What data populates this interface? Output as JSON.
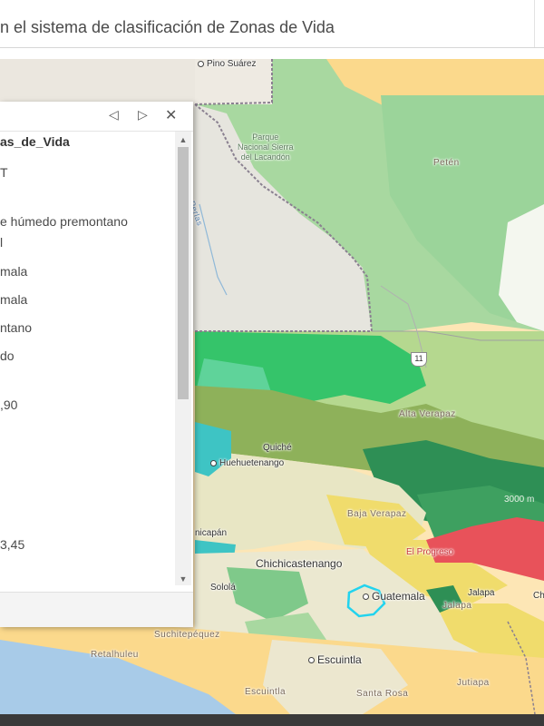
{
  "header": {
    "title": "n el sistema de clasificación de Zonas de Vida"
  },
  "popup": {
    "nav": {
      "prev": "◁",
      "next": "▷",
      "close": "✕"
    },
    "heading": "as_de_Vida",
    "rows": [
      "T",
      "e húmedo premontano",
      "l",
      "mala",
      "mala",
      "ntano",
      "do",
      ",90",
      "3,45"
    ]
  },
  "map": {
    "cities": {
      "pino_suarez": "Pino Suárez",
      "huehuetenango": "Huehuetenango",
      "chichicastenango": "Chichicastenango",
      "guatemala": "Guatemala",
      "jalapa": "Jalapa",
      "jalapa_dept": "Jalapa",
      "escuintla": "Escuintla",
      "solola": "Sololá",
      "quiche": "Quiché",
      "nicapan": "nicapán",
      "santa_rosa": "Santa Rosa",
      "escuintla_dept": "Escuintla",
      "suchitepequez": "Suchitepéquez",
      "retalhuleu": "Retalhuleu",
      "jutiapa": "Jutiapa",
      "chi": "Chi"
    },
    "regions": {
      "peten": "Petén",
      "alta_verapaz": "Alta Verapaz",
      "baja_verapaz": "Baja Verapaz",
      "el_progreso": "El Progreso",
      "perlas": "Perlas"
    },
    "park": [
      "Parque",
      "Nacional Sierra",
      "del Lacandón"
    ],
    "highway": "11",
    "elevation": "3000 m"
  },
  "colors": {
    "humid_forest": "#a8d8a0",
    "wet_forest": "#7fc98a",
    "dry_forest": "#fde6b5",
    "very_wet": "#35c46a",
    "montane": "#5fa860",
    "highland": "#8eb15a",
    "lower_montane": "#e7e4c0",
    "red_zone": "#e8525a",
    "yellow_zone": "#f0dc6c",
    "cyan_zone": "#3ec4c4",
    "ocean": "#a8cbe8"
  }
}
